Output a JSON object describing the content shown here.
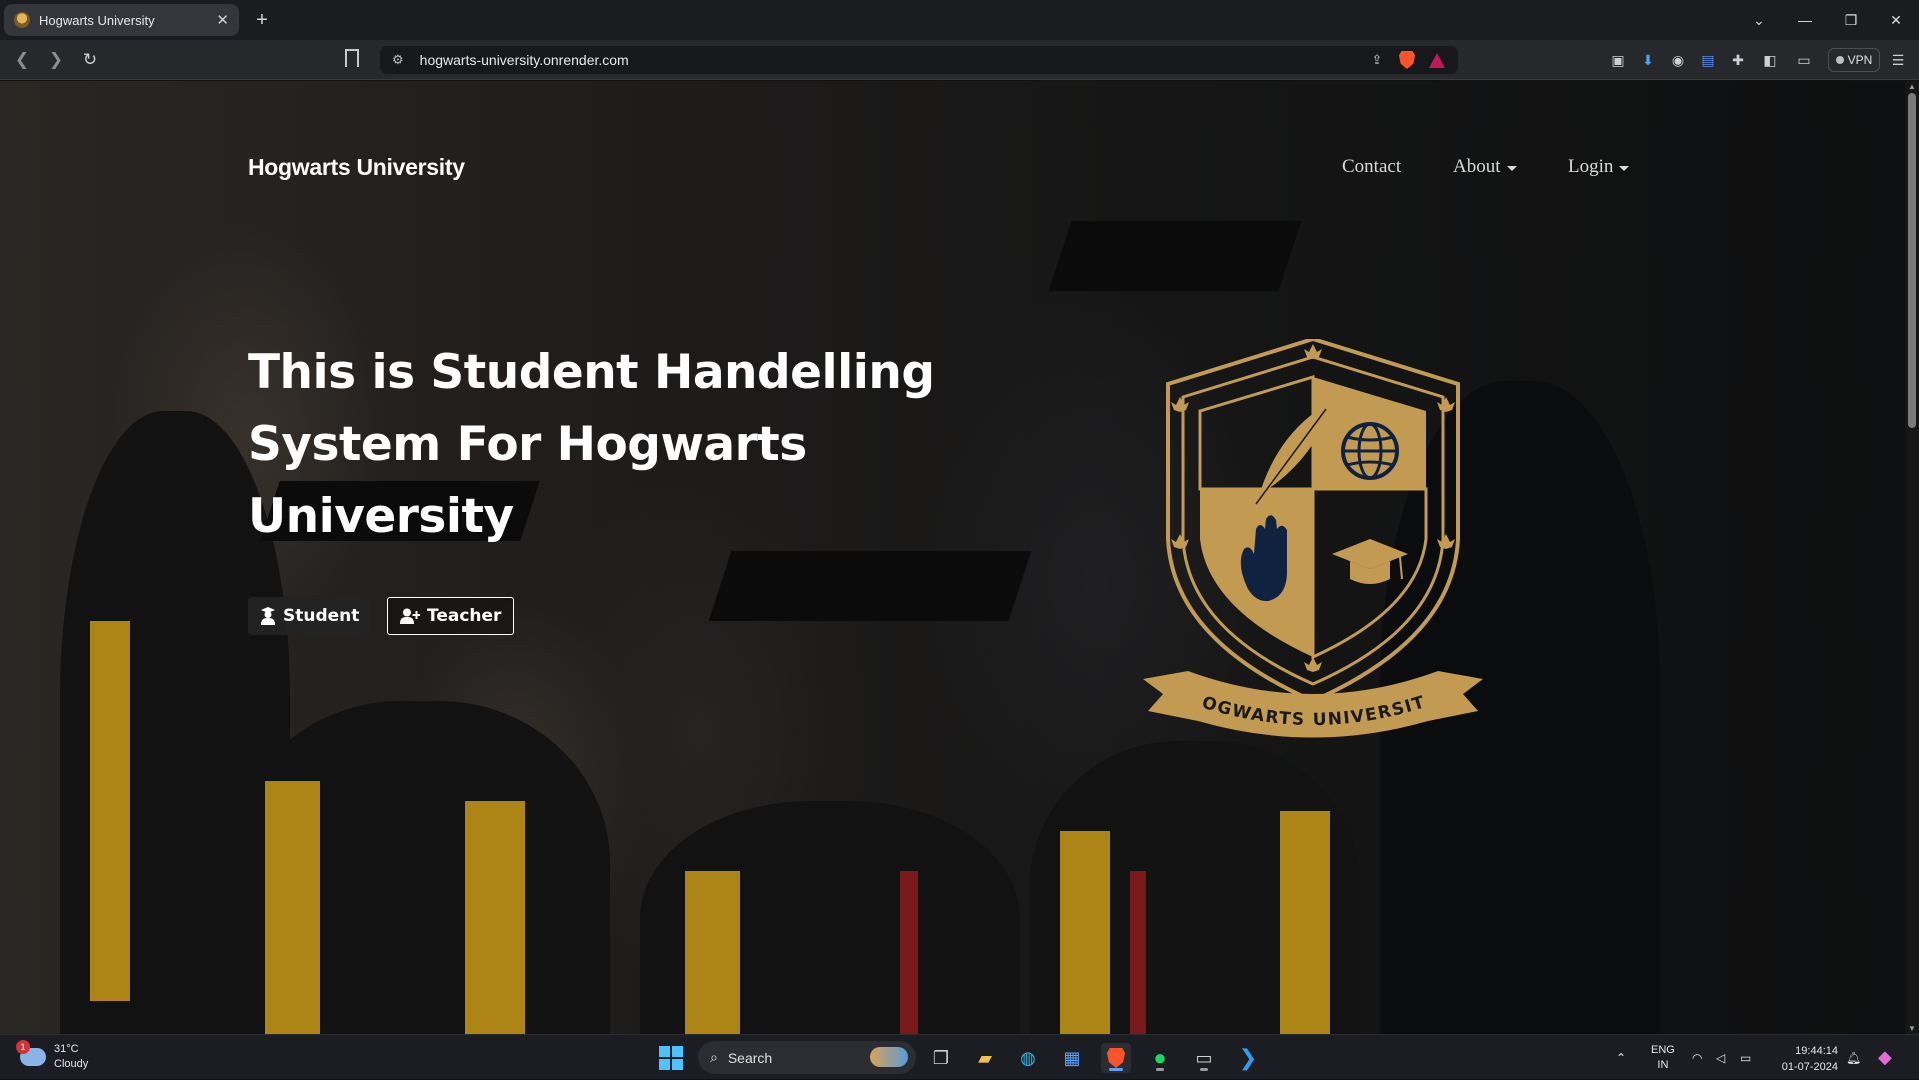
{
  "browser": {
    "tab_title": "Hogwarts University",
    "tab_close": "✕",
    "new_tab": "+",
    "url": "hogwarts-university.onrender.com",
    "vpn_label": "VPN"
  },
  "site": {
    "brand": "Hogwarts University",
    "nav": {
      "contact": "Contact",
      "about": "About",
      "login": "Login"
    },
    "hero_title": "This is Student Handelling System For Hogwarts University",
    "buttons": {
      "student": "Student",
      "teacher": "Teacher"
    },
    "crest_text": "HOGWARTS UNIVERSITY",
    "colors": {
      "gold": "#c39a52",
      "navy": "#0f2340"
    }
  },
  "taskbar": {
    "weather_temp": "31°C",
    "weather_desc": "Cloudy",
    "weather_badge": "1",
    "search_label": "Search",
    "lang_top": "ENG",
    "lang_bottom": "IN",
    "time": "19:44:14",
    "date": "01-07-2024"
  }
}
